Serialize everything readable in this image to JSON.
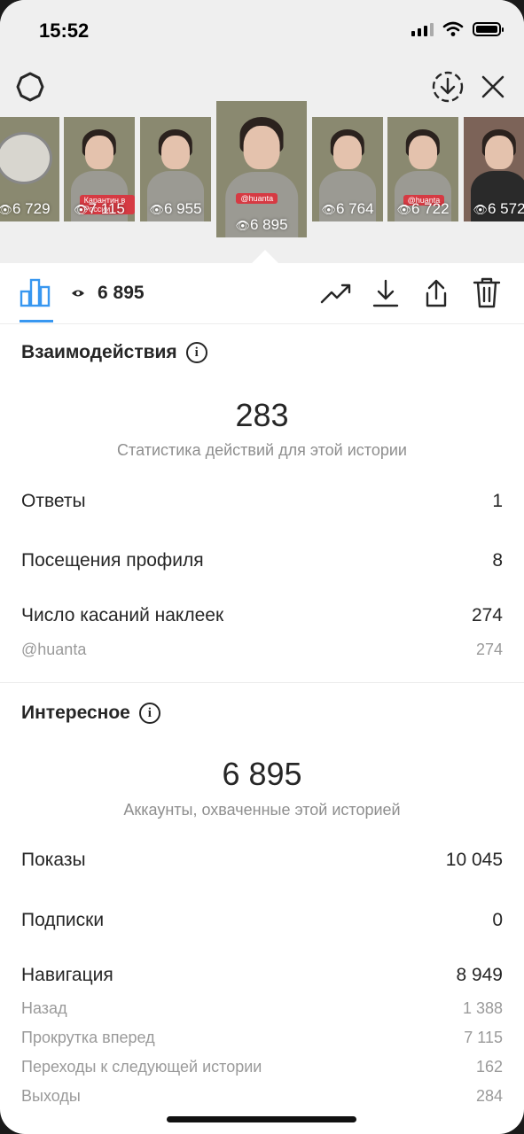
{
  "status_bar": {
    "time": "15:52"
  },
  "top_bar": {
    "settings_icon": "gear-icon",
    "save_icon": "download-circle-icon",
    "close_icon": "close-icon"
  },
  "stories": [
    {
      "views": "6 729",
      "kind": "bowl",
      "caption": ""
    },
    {
      "views": "7 115",
      "kind": "person",
      "caption": "Карантин в России"
    },
    {
      "views": "6 955",
      "kind": "person",
      "caption": ""
    },
    {
      "views": "6 895",
      "kind": "person",
      "caption": "@huanta",
      "active": true
    },
    {
      "views": "6 764",
      "kind": "person",
      "caption": ""
    },
    {
      "views": "6 722",
      "kind": "person",
      "caption": "@huanta"
    },
    {
      "views": "6 572",
      "kind": "dark",
      "caption": ""
    }
  ],
  "toolbar": {
    "views": "6 895",
    "icons": [
      "bar-chart-icon",
      "eye-icon",
      "trend-icon",
      "download-icon",
      "share-icon",
      "trash-icon"
    ]
  },
  "interactions": {
    "title": "Взаимодействия",
    "total": "283",
    "subtitle": "Статистика действий для этой истории",
    "rows": [
      {
        "label": "Ответы",
        "value": "1"
      },
      {
        "label": "Посещения профиля",
        "value": "8"
      },
      {
        "label": "Число касаний наклеек",
        "value": "274"
      }
    ],
    "sticker_rows": [
      {
        "label": "@huanta",
        "value": "274"
      }
    ]
  },
  "discovery": {
    "title": "Интересное",
    "total": "6 895",
    "subtitle": "Аккаунты, охваченные этой историей",
    "rows": [
      {
        "label": "Показы",
        "value": "10 045"
      },
      {
        "label": "Подписки",
        "value": "0"
      },
      {
        "label": "Навигация",
        "value": "8 949"
      }
    ],
    "navigation_rows": [
      {
        "label": "Назад",
        "value": "1 388"
      },
      {
        "label": "Прокрутка вперед",
        "value": "7 115"
      },
      {
        "label": "Переходы к следующей истории",
        "value": "162"
      },
      {
        "label": "Выходы",
        "value": "284"
      }
    ]
  },
  "colors": {
    "accent": "#3897f0",
    "muted": "#8e8e8e",
    "caption_red": "#d63a43"
  }
}
